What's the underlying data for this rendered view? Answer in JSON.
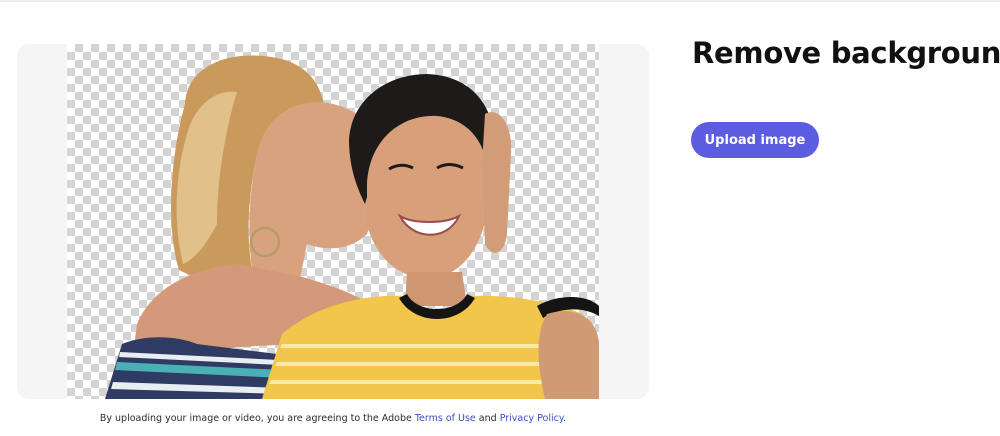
{
  "page": {
    "title": "Remove background",
    "upload_button_label": "Upload image"
  },
  "preview": {
    "description_alt": "Two women, one kissing the cheek of the other, with the background removed on a transparency checkerboard"
  },
  "terms": {
    "prefix": "By uploading your image or video, you are agreeing to the Adobe ",
    "terms_link": "Terms of Use",
    "and": " and ",
    "privacy_link": "Privacy Policy",
    "suffix": "."
  },
  "colors": {
    "accent": "#5c5ce0",
    "link": "#3b4fc4",
    "card_bg": "#f5f5f5"
  },
  "icons": []
}
